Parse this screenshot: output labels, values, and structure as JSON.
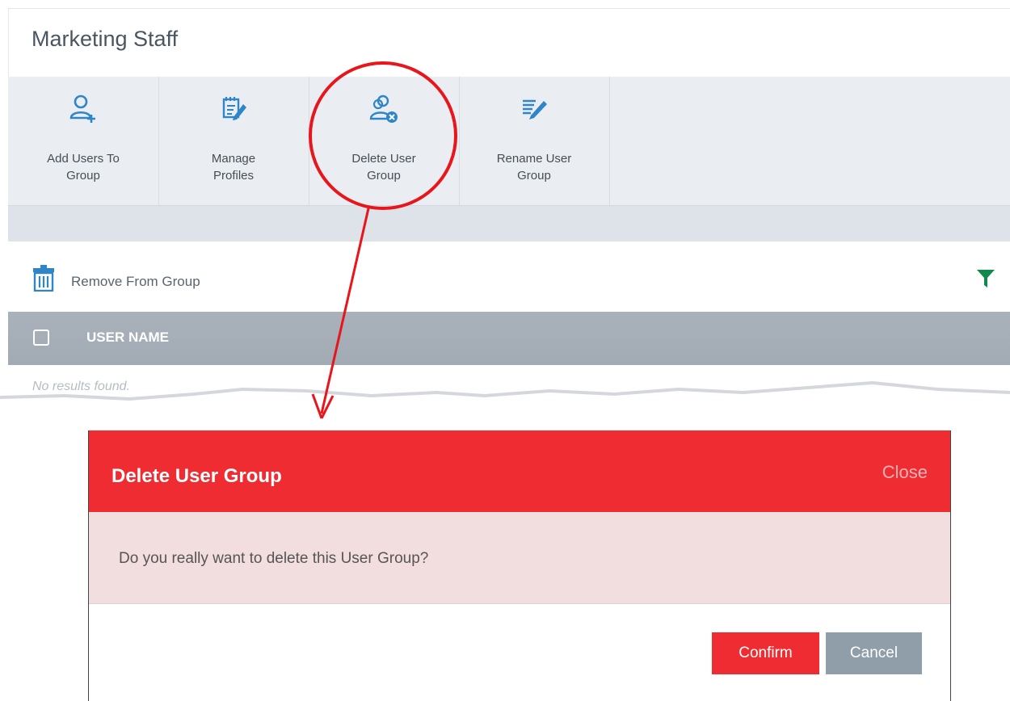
{
  "page": {
    "title": "Marketing Staff"
  },
  "toolbar": {
    "items": [
      {
        "label": "Add Users To\nGroup",
        "icon": "add-user-icon"
      },
      {
        "label": "Manage\nProfiles",
        "icon": "manage-profiles-icon"
      },
      {
        "label": "Delete User\nGroup",
        "icon": "delete-user-group-icon"
      },
      {
        "label": "Rename User\nGroup",
        "icon": "rename-group-icon"
      }
    ]
  },
  "actions": {
    "remove_label": "Remove From Group",
    "remove_icon": "trash-icon",
    "filter_icon": "filter-icon"
  },
  "table": {
    "column_header": "USER NAME",
    "empty_text": "No results found."
  },
  "dialog": {
    "title": "Delete User Group",
    "close_label": "Close",
    "message": "Do you really want to delete this User Group?",
    "confirm_label": "Confirm",
    "cancel_label": "Cancel"
  },
  "colors": {
    "accent_red": "#ee2c32",
    "icon_blue": "#2f86c6",
    "filter_green": "#0f8a4a",
    "cancel_gray": "#8f9ea8"
  }
}
